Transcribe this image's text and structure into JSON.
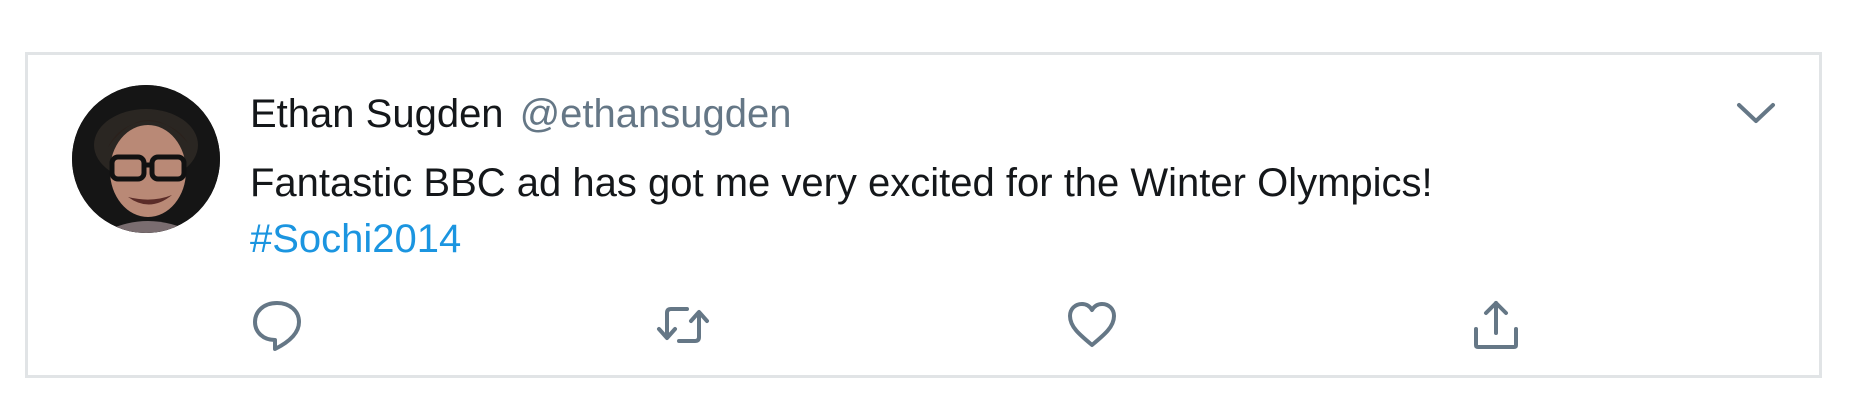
{
  "tweet": {
    "author": {
      "display_name": "Ethan Sugden",
      "handle": "@ethansugden"
    },
    "text": "Fantastic BBC ad has got me very excited for the Winter Olympics!",
    "hashtag": "#Sochi2014"
  },
  "colors": {
    "text": "#14171a",
    "secondary": "#657786",
    "link": "#1b95e0",
    "border": "#e1e4e6"
  },
  "icons": {
    "menu": "chevron-down-icon",
    "reply": "reply-icon",
    "retweet": "retweet-icon",
    "like": "heart-icon",
    "share": "share-icon"
  }
}
